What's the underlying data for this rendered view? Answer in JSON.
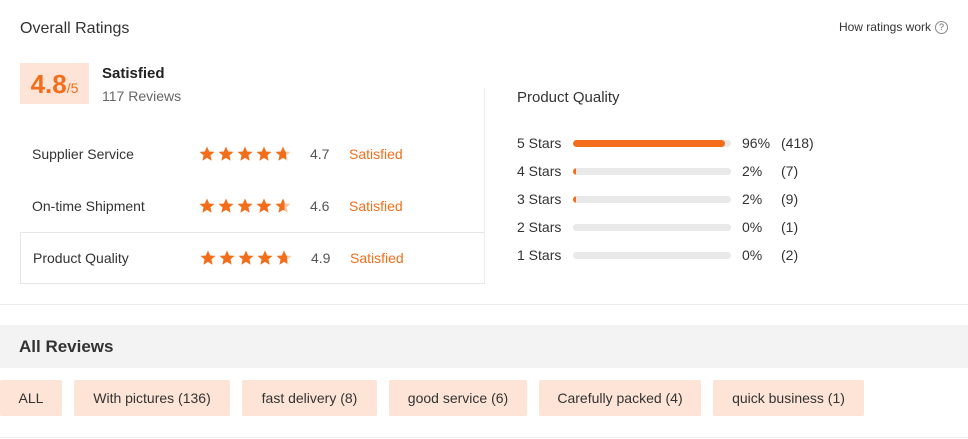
{
  "header": {
    "title": "Overall Ratings",
    "how_link": "How ratings work",
    "help_glyph": "?"
  },
  "overall": {
    "score": "4.8",
    "out_of": "/5",
    "label": "Satisfied",
    "reviews": "117 Reviews"
  },
  "categories": [
    {
      "name": "Supplier Service",
      "rating_value": 4.7,
      "rating": "4.7",
      "status": "Satisfied",
      "selected": false
    },
    {
      "name": "On-time Shipment",
      "rating_value": 4.6,
      "rating": "4.6",
      "status": "Satisfied",
      "selected": false
    },
    {
      "name": "Product Quality",
      "rating_value": 4.9,
      "rating": "4.9",
      "status": "Satisfied",
      "selected": true
    }
  ],
  "distribution": {
    "title": "Product Quality",
    "rows": [
      {
        "label": "5 Stars",
        "percent_value": 96,
        "percent": "96%",
        "count": "(418)"
      },
      {
        "label": "4 Stars",
        "percent_value": 2,
        "percent": "2%",
        "count": "(7)"
      },
      {
        "label": "3 Stars",
        "percent_value": 2,
        "percent": "2%",
        "count": "(9)"
      },
      {
        "label": "2 Stars",
        "percent_value": 0,
        "percent": "0%",
        "count": "(1)"
      },
      {
        "label": "1 Stars",
        "percent_value": 0,
        "percent": "0%",
        "count": "(2)"
      }
    ]
  },
  "reviews_section": {
    "title": "All Reviews",
    "filters": [
      "ALL",
      "With pictures (136)",
      "fast delivery (8)",
      "good service (6)",
      "Carefully packed (4)",
      "quick business (1)"
    ]
  },
  "colors": {
    "accent": "#f26e1a",
    "chip_bg": "#fde4d6",
    "track": "#e9e9e9"
  },
  "icons": {
    "help": "question-circle-icon",
    "star": "star-icon"
  }
}
